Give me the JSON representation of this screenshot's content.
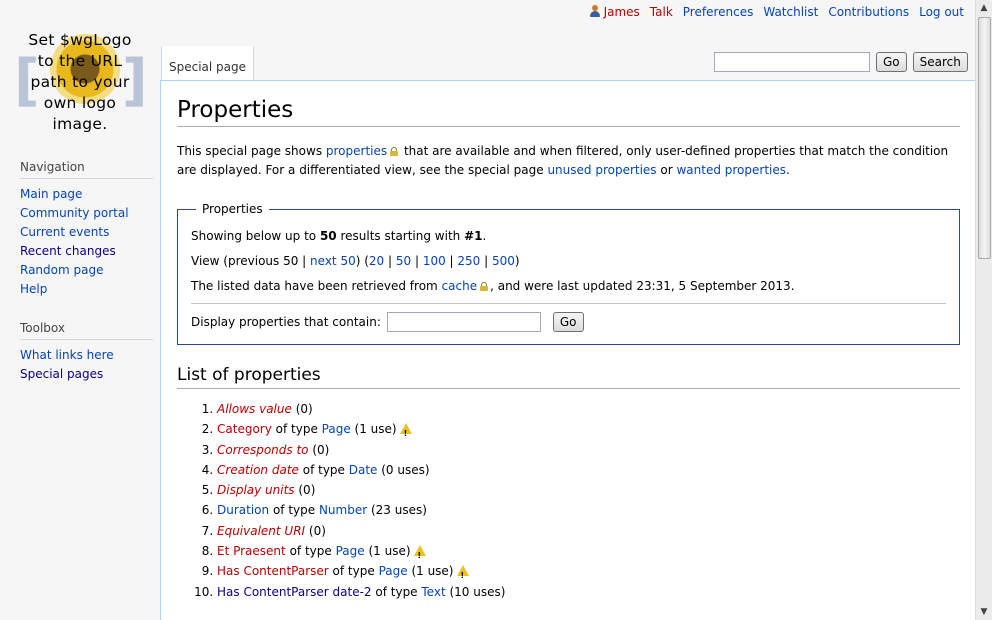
{
  "personal": {
    "user": "James",
    "talk": "Talk",
    "preferences": "Preferences",
    "watchlist": "Watchlist",
    "contributions": "Contributions",
    "logout": "Log out"
  },
  "logo": {
    "lines": [
      "Set $wgLogo",
      "to the URL",
      "path to your",
      "own logo",
      "image."
    ]
  },
  "tabs": {
    "special_page": "Special page"
  },
  "search": {
    "placeholder": "",
    "go": "Go",
    "search": "Search"
  },
  "sidebar": {
    "navigation_title": "Navigation",
    "navigation": [
      "Main page",
      "Community portal",
      "Current events",
      "Recent changes",
      "Random page",
      "Help"
    ],
    "toolbox_title": "Toolbox",
    "toolbox": [
      "What links here",
      "Special pages"
    ]
  },
  "page": {
    "title": "Properties",
    "intro": {
      "t1": "This special page shows ",
      "link_properties": "properties",
      "t2": " that are available and when filtered, only user-defined properties that match the condition are displayed. For a differentiated view, see the special page ",
      "link_unused": "unused properties",
      "t3": " or ",
      "link_wanted": "wanted properties",
      "t4": "."
    },
    "fieldset": {
      "legend": "Properties",
      "showing_prefix": "Showing below up to ",
      "showing_count": "50",
      "showing_mid": " results starting with ",
      "showing_start": "#1",
      "showing_end": ".",
      "view_prefix": "View (previous 50 | ",
      "next50": "next 50",
      "view_mid": ") (",
      "n20": "20",
      "n50": "50",
      "n100": "100",
      "n250": "250",
      "n500": "500",
      "sep": " | ",
      "close": ")",
      "cache_prefix": "The listed data have been retrieved from ",
      "cache_link": "cache",
      "cache_suffix": ", and were last updated 23:31, 5 September 2013.",
      "filter_label": "Display properties that contain:",
      "filter_go": "Go"
    },
    "list_heading": "List of properties",
    "properties": [
      {
        "name": "Allows value",
        "rest": " (0)"
      },
      {
        "name": "Category",
        "of": " of type ",
        "type": "Page",
        "rest": " (1 use)",
        "warn": true
      },
      {
        "name": "Corresponds to",
        "rest": " (0)"
      },
      {
        "name": "Creation date",
        "of": " of type ",
        "type": "Date",
        "rest": " (0 uses)"
      },
      {
        "name": "Display units",
        "rest": " (0)"
      },
      {
        "name": "Duration",
        "of": " of type ",
        "type": "Number",
        "rest": " (23 uses)"
      },
      {
        "name": "Equivalent URI",
        "rest": " (0)"
      },
      {
        "name": "Et Praesent",
        "of": " of type ",
        "type": "Page",
        "rest": " (1 use)",
        "warn": true
      },
      {
        "name": "Has ContentParser",
        "of": " of type ",
        "type": "Page",
        "rest": " (1 use)",
        "warn": true
      },
      {
        "name": "Has ContentParser date-2",
        "of": " of type ",
        "type": "Text",
        "rest": " (10 uses)"
      }
    ]
  }
}
